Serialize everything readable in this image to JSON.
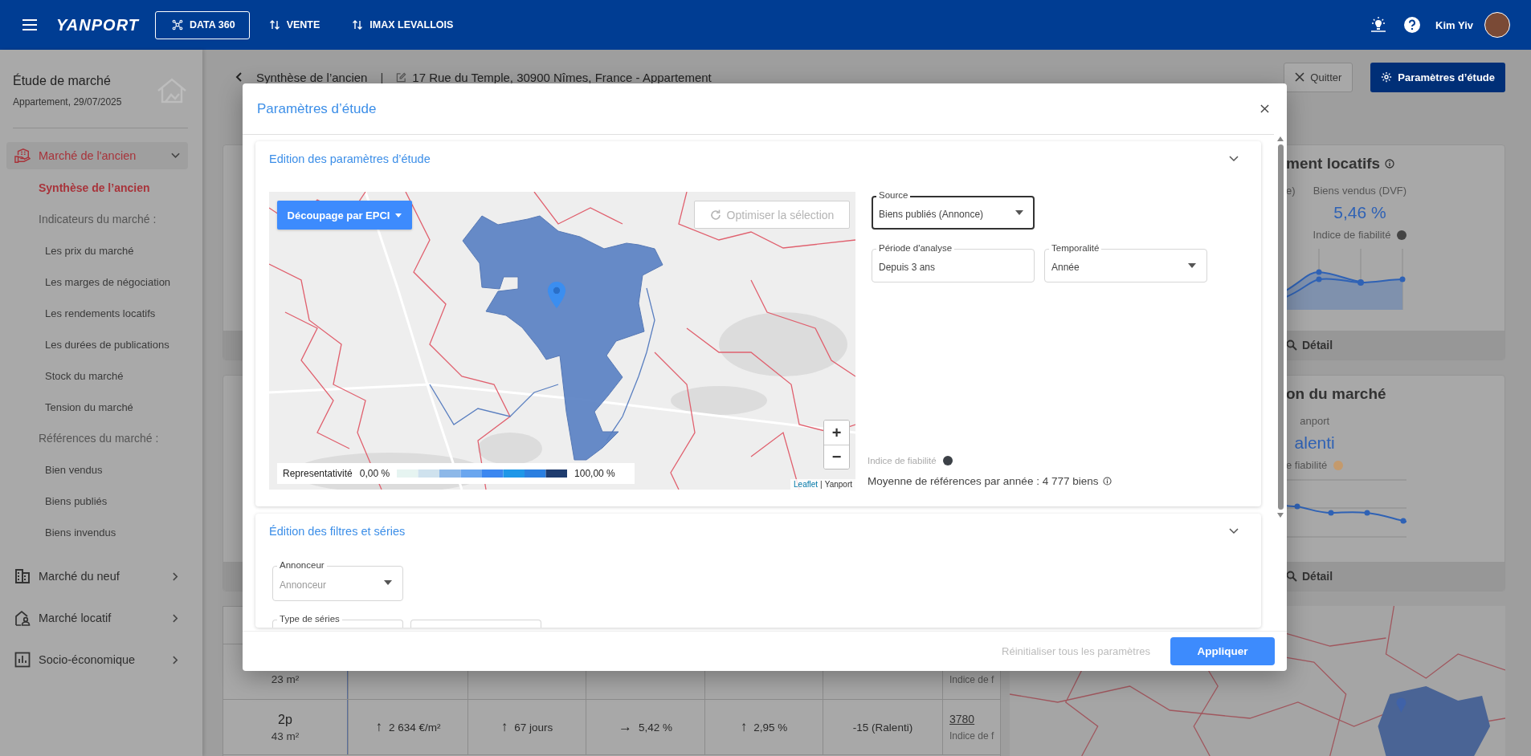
{
  "top_bar": {
    "logo": "YANPORT",
    "nav": [
      {
        "label": "DATA 360",
        "selected": true
      },
      {
        "label": "VENTE",
        "selected": false
      },
      {
        "label": "IMAX LEVALLOIS",
        "selected": false
      }
    ],
    "user": "Kim Yiv"
  },
  "sidebar": {
    "title": "Étude de marché",
    "subtitle": "Appartement, 29/07/2025",
    "sections": [
      {
        "label": "Marché de l'ancien",
        "selected": true,
        "expanded": true,
        "children": [
          {
            "kind": "link",
            "label": "Synthèse de l’ancien",
            "selected": true
          },
          {
            "kind": "group",
            "label": "Indicateurs du marché :",
            "children": [
              {
                "label": "Les prix du marché",
                "selected": false
              },
              {
                "label": "Les marges de négociation",
                "selected": false
              },
              {
                "label": "Les rendements locatifs",
                "selected": false
              },
              {
                "label": "Les durées de publications",
                "selected": false
              },
              {
                "label": "Stock du marché",
                "selected": false
              },
              {
                "label": "Tension du marché",
                "selected": false
              }
            ]
          },
          {
            "kind": "group",
            "label": "Références du marché :",
            "children": [
              {
                "label": "Bien vendus",
                "selected": false
              },
              {
                "label": "Biens publiés",
                "selected": false
              },
              {
                "label": "Biens invendus",
                "selected": false
              }
            ]
          }
        ]
      },
      {
        "label": "Marché du neuf",
        "selected": false,
        "expanded": false
      },
      {
        "label": "Marché locatif",
        "selected": false,
        "expanded": false
      },
      {
        "label": "Socio-économique",
        "selected": false,
        "expanded": false
      }
    ]
  },
  "breadcrumb": {
    "page": "Synthèse de l’ancien",
    "separator": "|",
    "address": "17 Rue du Temple, 30900 Nîmes, France - Appartement"
  },
  "actions": [
    {
      "label": "Quitter",
      "kind": "secondary"
    },
    {
      "label": "Paramètres d’étude",
      "kind": "primary"
    }
  ],
  "cards": [
    {
      "title": "ment locatifs",
      "kind": "area",
      "columns": [
        {
          "label": "e)"
        },
        {
          "label": "Biens vendus (DVF)",
          "value": "5,46 %",
          "reliability": {
            "label": "Indice de fiabilité",
            "color": "#444444"
          }
        }
      ],
      "detail": "Détail"
    },
    {
      "title": "on du marché",
      "kind": "line",
      "columns": [
        {
          "label": "anport",
          "value": "alenti",
          "reliability": {
            "label": "e fiabilité",
            "color": "#c49a6c"
          }
        }
      ],
      "detail": "Détail"
    }
  ],
  "table": {
    "rows": [
      {
        "surface": "23 m²",
        "reliability": "Indice de f"
      },
      {
        "type": "2p",
        "surface": "43 m²",
        "metrics": [
          {
            "value": "2 634 €/m²",
            "arrow": "↑"
          },
          {
            "value": "67 jours",
            "arrow": "↑"
          },
          {
            "value": "5,42 %",
            "arrow": "→"
          },
          {
            "value": "2,95 %",
            "arrow": "↑"
          }
        ],
        "tension": "-15 (Ralenti)",
        "count": "3780",
        "reliability": "Indice de f"
      }
    ]
  },
  "modal": {
    "title": "Paramètres d’étude",
    "sections": [
      {
        "title": "Edition des paramètres d’étude",
        "expanded": true,
        "map": {
          "split_button": "Découpage par EPCI",
          "optimize_button": {
            "label": "Optimiser la sélection",
            "disabled": true
          },
          "legend": {
            "label": "Representativité",
            "min": "0,00 %",
            "max": "100,00 %"
          },
          "zoom_in": "+",
          "zoom_out": "−",
          "attribution": {
            "link": "Leaflet",
            "separator": "|",
            "text": "Yanport"
          }
        },
        "fields": [
          {
            "label": "Source",
            "value": "Biens publiés (Annonce)",
            "kind": "select",
            "focused": true
          },
          {
            "label": "Période d'analyse",
            "value": "Depuis 3 ans",
            "kind": "text",
            "focused": false
          },
          {
            "label": "Temporalité",
            "value": "Année",
            "kind": "select",
            "focused": false
          }
        ],
        "reliability": {
          "label": "Indice de fiabilité",
          "color": "#3c4147"
        },
        "average": "Moyenne de références par année : 4 777 biens"
      },
      {
        "title": "Édition des filtres et séries",
        "expanded": true,
        "fields": [
          {
            "label": "Annonceur",
            "placeholder": "Annonceur",
            "kind": "select",
            "focused": false
          },
          {
            "label": "Type de séries",
            "kind": "select",
            "focused": false
          },
          {
            "kind": "text",
            "focused": false
          }
        ]
      }
    ],
    "footer": {
      "reset": {
        "label": "Réinitialiser tous les paramètres",
        "disabled": true
      },
      "apply": "Appliquer"
    }
  }
}
